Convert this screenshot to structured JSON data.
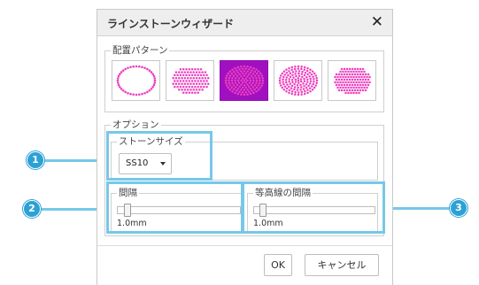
{
  "dialog": {
    "title": "ラインストーンウィザード",
    "close_icon": "close-icon"
  },
  "pattern_group": {
    "label": "配置パターン",
    "patterns": [
      {
        "name": "outline-ellipse",
        "selected": false
      },
      {
        "name": "filled-ellipse-grid",
        "selected": false
      },
      {
        "name": "filled-ellipse-concentric",
        "selected": true
      },
      {
        "name": "filled-ellipse-radial",
        "selected": false
      },
      {
        "name": "filled-ellipse-rows",
        "selected": false
      }
    ],
    "dot_color": "#ee3fbf",
    "selected_color": "#a010c0"
  },
  "options_group": {
    "label": "オプション",
    "stone_size": {
      "label": "ストーンサイズ",
      "value": "SS10"
    },
    "spacing": {
      "label": "間隔",
      "value_text": "1.0mm",
      "level": 0.05
    },
    "contour_spacing": {
      "label": "等高線の間隔",
      "value_text": "1.0mm",
      "level": 0.05
    }
  },
  "footer": {
    "ok_label": "OK",
    "cancel_label": "キャンセル"
  },
  "callouts": {
    "badge_1": "1",
    "badge_2": "2",
    "badge_3": "3",
    "color": "#76c8e8",
    "badge_color": "#2da1d6"
  }
}
